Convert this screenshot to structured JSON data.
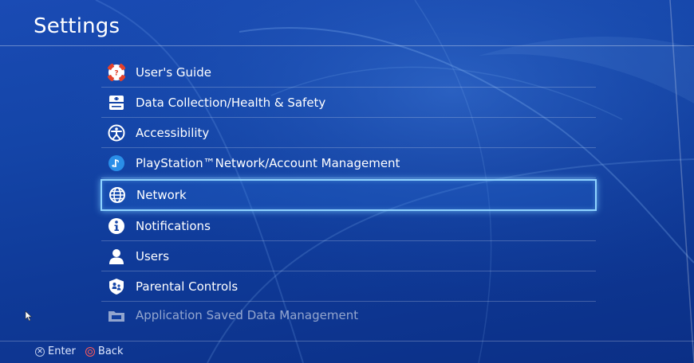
{
  "header": {
    "title": "Settings"
  },
  "menu": {
    "items": [
      {
        "label": "User's Guide",
        "icon": "lifebuoy-icon"
      },
      {
        "label": "Data Collection/Health & Safety",
        "icon": "data-collection-icon"
      },
      {
        "label": "Accessibility",
        "icon": "accessibility-icon"
      },
      {
        "label": "PlayStation™Network/Account Management",
        "icon": "playstation-network-icon"
      },
      {
        "label": "Network",
        "icon": "globe-icon",
        "selected": true
      },
      {
        "label": "Notifications",
        "icon": "info-icon"
      },
      {
        "label": "Users",
        "icon": "user-icon"
      },
      {
        "label": "Parental Controls",
        "icon": "parental-controls-icon"
      },
      {
        "label": "Application Saved Data Management",
        "icon": "saved-data-icon"
      }
    ]
  },
  "footer": {
    "enter_label": "Enter",
    "back_label": "Back",
    "enter_button_icon": "cross-button-icon",
    "back_button_icon": "circle-button-icon"
  },
  "colors": {
    "background": "#1445a8",
    "selection_border": "#8fd3ff",
    "lifebuoy_red": "#e3412b",
    "psn_blue": "#2a8ee8"
  }
}
